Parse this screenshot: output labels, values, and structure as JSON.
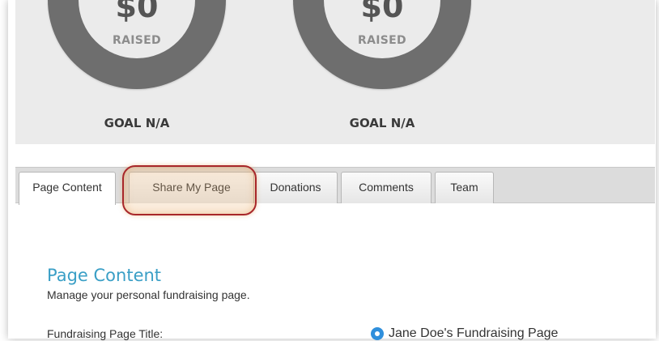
{
  "stats": {
    "gauges": [
      {
        "amount": "$0",
        "raised_label": "RAISED",
        "goal_label": "GOAL N/A"
      },
      {
        "amount": "$0",
        "raised_label": "RAISED",
        "goal_label": "GOAL N/A"
      }
    ]
  },
  "tabs": [
    {
      "label": "Page Content",
      "active": true
    },
    {
      "label": "Share My Page",
      "active": false,
      "highlighted": true
    },
    {
      "label": "Donations",
      "active": false
    },
    {
      "label": "Comments",
      "active": false
    },
    {
      "label": "Team",
      "active": false
    }
  ],
  "content": {
    "title": "Page Content",
    "subtitle": "Manage your personal fundraising page.",
    "field_label": "Fundraising Page Title:",
    "title_option": "Jane Doe's Fundraising Page"
  },
  "colors": {
    "accent": "#3a9fc6",
    "gauge_ring": "#6e6e6e",
    "highlight": "#a8272a",
    "radio": "#2f8fdc"
  }
}
